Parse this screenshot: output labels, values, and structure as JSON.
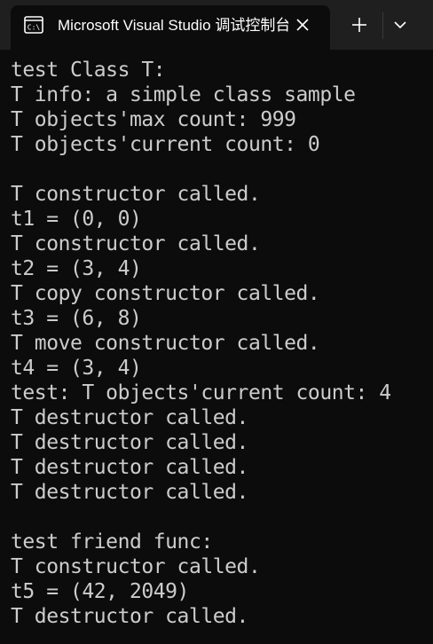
{
  "window": {
    "tab_title": "Microsoft Visual Studio 调试控制台",
    "icons": {
      "tab_icon": "console-icon",
      "close": "close-icon",
      "new_tab": "plus-icon",
      "dropdown": "chevron-down-icon"
    }
  },
  "console": {
    "lines": [
      "test Class T:",
      "T info: a simple class sample",
      "T objects'max count: 999",
      "T objects'current count: 0",
      "",
      "T constructor called.",
      "t1 = (0, 0)",
      "T constructor called.",
      "t2 = (3, 4)",
      "T copy constructor called.",
      "t3 = (6, 8)",
      "T move constructor called.",
      "t4 = (3, 4)",
      "test: T objects'current count: 4",
      "T destructor called.",
      "T destructor called.",
      "T destructor called.",
      "T destructor called.",
      "",
      "test friend func:",
      "T constructor called.",
      "t5 = (42, 2049)",
      "T destructor called."
    ]
  },
  "colors": {
    "background": "#0c0c0c",
    "titlebar": "#1f1f1f",
    "text": "#cccccc"
  }
}
